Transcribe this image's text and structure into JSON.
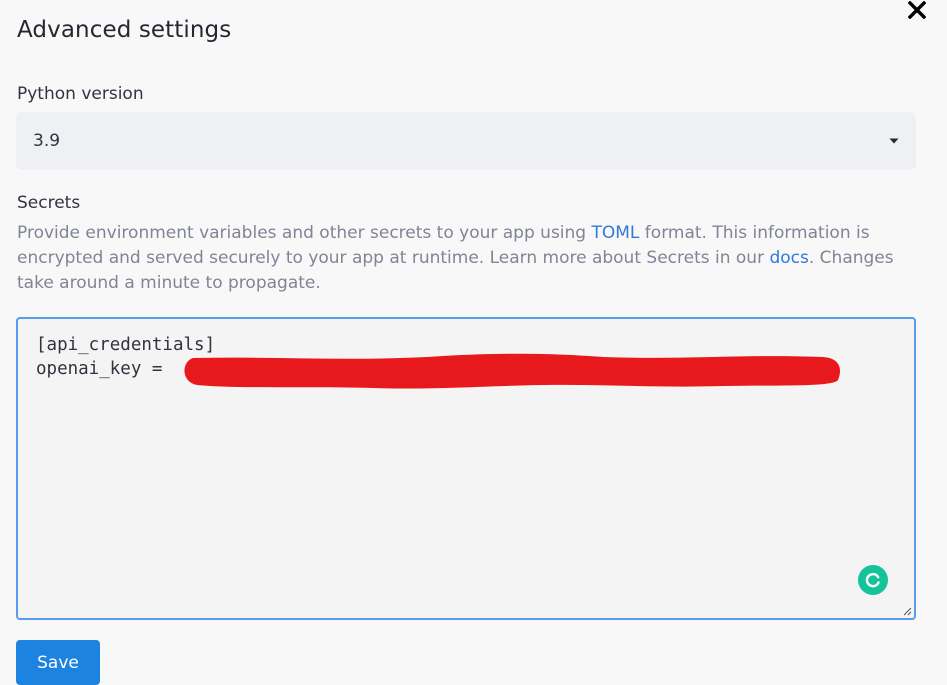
{
  "dialog": {
    "title": "Advanced settings",
    "close_icon": "close-icon"
  },
  "python_version": {
    "label": "Python version",
    "selected": "3.9",
    "dropdown_icon": "caret-down-icon"
  },
  "secrets": {
    "label": "Secrets",
    "description": {
      "text_before_toml": "Provide environment variables and other secrets to your app using ",
      "toml_link": "TOML",
      "text_after_toml": " format. This information is encrypted and served securely to your app at runtime. Learn more about Secrets in our ",
      "docs_link": "docs",
      "text_after_docs": ". Changes take around a minute to propagate."
    },
    "editor": {
      "lines": [
        "[api_credentials]",
        "openai_key ="
      ],
      "redaction_color": "#e8191c",
      "assistant_icon": "grammarly-icon",
      "resize_icon": "resize-grip-icon",
      "focus_border_color": "#5b9ce9"
    }
  },
  "actions": {
    "save_label": "Save",
    "save_color": "#1c83e1"
  },
  "colors": {
    "link": "#2f7ad6",
    "muted_text": "#808495",
    "select_background": "#eff0f3"
  }
}
